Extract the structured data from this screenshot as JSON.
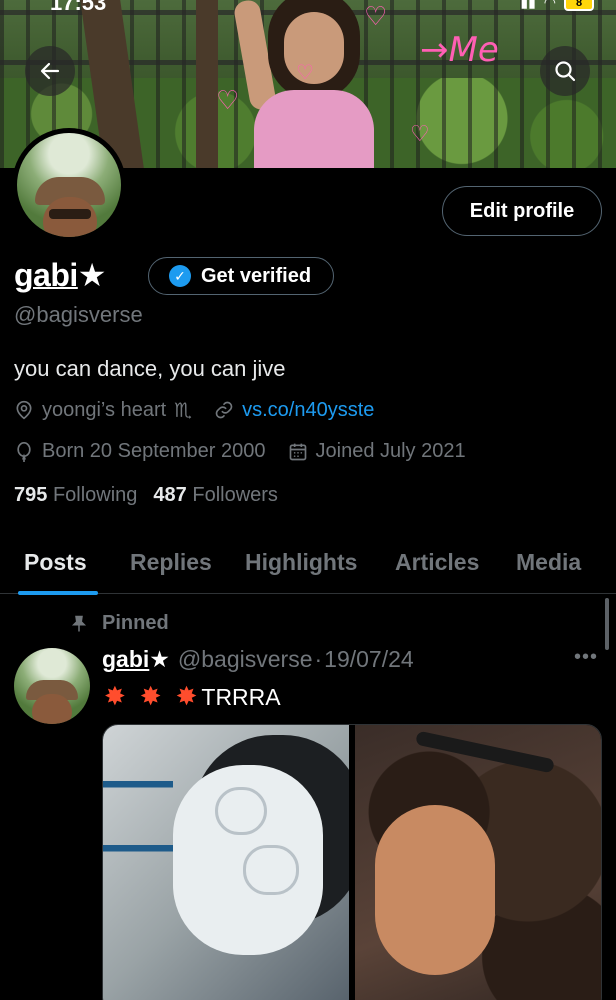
{
  "status_bar": {
    "time": "17:53",
    "battery": "8"
  },
  "banner": {
    "doodle_text": "→Me",
    "hearts": [
      "♡",
      "♡",
      "♡",
      "♡"
    ]
  },
  "header": {
    "back_icon": "arrow-left-icon",
    "search_icon": "search-icon",
    "edit_profile_label": "Edit profile"
  },
  "profile": {
    "name": "gabi",
    "name_decoration": "★",
    "get_verified_label": "Get verified",
    "handle": "@bagisverse",
    "bio": "you can dance, you can jive",
    "location": "yoongi’s heart",
    "location_suffix": "♏",
    "website": "vs.co/n40ysste",
    "birthday": "Born 20 September 2000",
    "joined": "Joined July 2021",
    "following_count": "795",
    "following_label": "Following",
    "followers_count": "487",
    "followers_label": "Followers"
  },
  "tabs": [
    {
      "label": "Posts",
      "active": true
    },
    {
      "label": "Replies",
      "active": false
    },
    {
      "label": "Highlights",
      "active": false
    },
    {
      "label": "Articles",
      "active": false
    },
    {
      "label": "Media",
      "active": false
    }
  ],
  "post": {
    "pinned_label": "Pinned",
    "author_name": "gabi",
    "author_decoration": "★",
    "author_handle": "@bagisverse",
    "separator": "·",
    "date": "19/07/24",
    "more": "•••",
    "emojis": [
      "✸",
      "✸",
      "✸"
    ],
    "text": "TRRRA"
  },
  "colors": {
    "accent": "#1d9bf0",
    "background": "#000000",
    "secondary_text": "#71767b",
    "border": "#2f3336"
  }
}
